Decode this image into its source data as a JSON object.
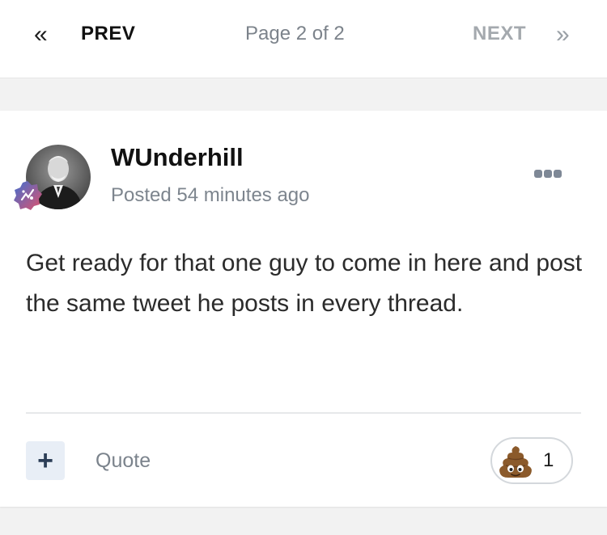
{
  "pagination": {
    "prev_icon": "«",
    "prev_label": "PREV",
    "page_info": "Page 2 of 2",
    "next_label": "NEXT",
    "next_icon": "»"
  },
  "post": {
    "author": "WUnderhill",
    "posted": "Posted 54 minutes ago",
    "body": "Get ready for that one guy to come in here and post the same tweet he posts in every thread.",
    "actions": {
      "add_icon": "+",
      "quote_label": "Quote"
    },
    "reaction": {
      "icon": "poop-emoji",
      "count": "1"
    }
  },
  "colors": {
    "accent": "#2c3e57",
    "muted": "#7d858e",
    "badge_gradient": [
      "#3f6fd1",
      "#e0516b"
    ]
  }
}
